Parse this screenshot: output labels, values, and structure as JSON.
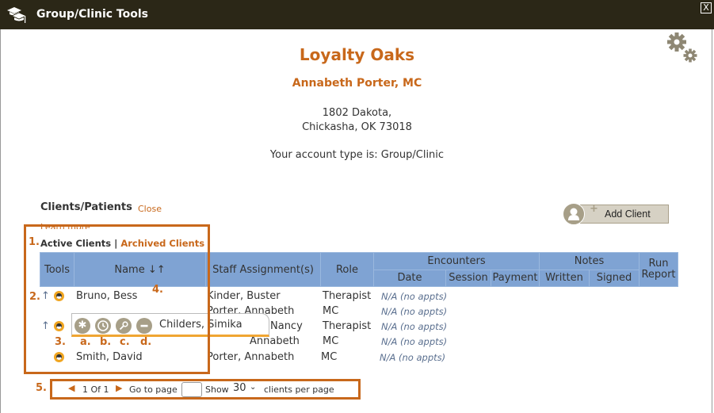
{
  "window": {
    "title": "Group/Clinic Tools",
    "close_label": "X"
  },
  "practice": {
    "name": "Loyalty Oaks",
    "owner": "Annabeth Porter, MC",
    "address_line1": "1802 Dakota,",
    "address_line2": "Chickasha, OK 73018",
    "account_type": "Your account type is: Group/Clinic"
  },
  "clients_section": {
    "title": "Clients/Patients",
    "close_link": "Close",
    "learn_more": "Learn more",
    "tab_active": "Active Clients",
    "separator": "|",
    "tab_archived": "Archived Clients",
    "add_client_label": "Add Client"
  },
  "table": {
    "headers": {
      "tools": "Tools",
      "name": "Name",
      "sort_icon": "↓↑",
      "staff": "Staff Assignment(s)",
      "role": "Role",
      "encounters": "Encounters",
      "notes": "Notes",
      "run": "Run",
      "report": "Report",
      "date": "Date",
      "session": "Session",
      "payment": "Payment",
      "written": "Written",
      "signed": "Signed"
    },
    "rows": [
      {
        "name": "Bruno, Bess",
        "staff": "Kinder, Buster",
        "role": "Therapist",
        "date": "N/A (no appts)"
      },
      {
        "name": "",
        "staff": "Porter, Annabeth",
        "role": "MC",
        "date": "N/A (no appts)"
      },
      {
        "name": "Childers, Simika",
        "staff": "Nancy",
        "role": "Therapist",
        "date": "N/A (no appts)"
      },
      {
        "name": "",
        "staff": "Annabeth",
        "role": "MC",
        "date": "N/A (no appts)"
      },
      {
        "name": "Smith, David",
        "staff": "Porter, Annabeth",
        "role": "MC",
        "date": "N/A (no appts)"
      }
    ],
    "popup": {
      "name": "Childers, Simika",
      "icons": [
        "asterisk-icon",
        "history-icon",
        "key-icon",
        "minus-icon"
      ]
    }
  },
  "annotations": {
    "n1": "1.",
    "n2": "2.",
    "n3": "3.",
    "n4": "4.",
    "n5": "5.",
    "a": "a.",
    "b": "b.",
    "c": "c.",
    "d": "d."
  },
  "pager": {
    "page_info": "1 Of 1",
    "goto_label": "Go to page",
    "goto_value": "",
    "show_label": "Show",
    "per_page": "30",
    "suffix": "clients per page"
  },
  "colors": {
    "accent": "#c8681b",
    "header_bg": "#7fa3d3",
    "titlebar": "#2b2717"
  }
}
